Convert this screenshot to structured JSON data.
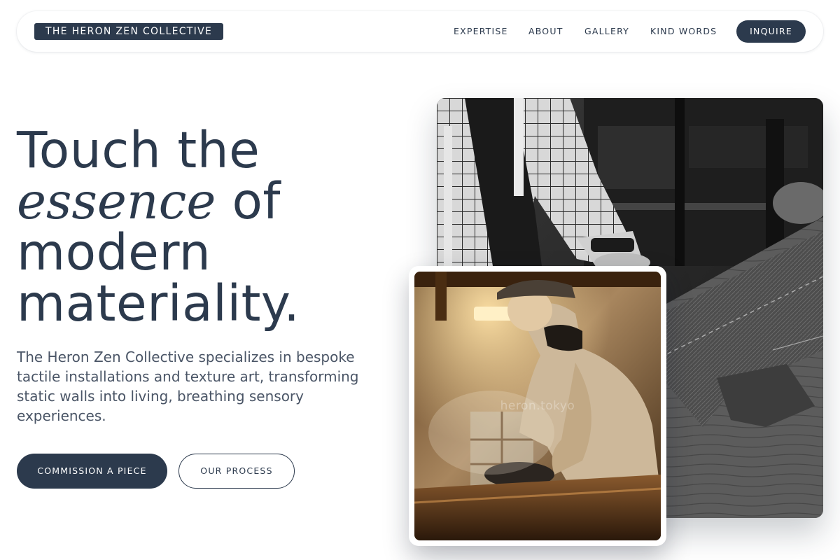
{
  "nav": {
    "brand": "THE HERON ZEN COLLECTIVE",
    "links": [
      "EXPERTISE",
      "ABOUT",
      "GALLERY",
      "KIND WORDS"
    ],
    "cta": "INQUIRE"
  },
  "hero": {
    "headline": {
      "line1": "Touch the",
      "emphasis": "essence",
      "line2_rest": " of",
      "line3": "modern",
      "line4": "materiality."
    },
    "description": "The Heron Zen Collective specializes in bespoke tactile installations and texture art, transforming static walls into living, breathing sensory experiences.",
    "primary_button": "COMMISSION A PIECE",
    "secondary_button": "OUR PROCESS"
  },
  "images": {
    "main": "tailor-cutting-fabric-photo",
    "inset": "craftsman-workshop-photo",
    "inset_watermark": "heron.tokyo"
  },
  "colors": {
    "primary": "#2c3a4d",
    "text_muted": "#4a5566",
    "background": "#ffffff"
  }
}
